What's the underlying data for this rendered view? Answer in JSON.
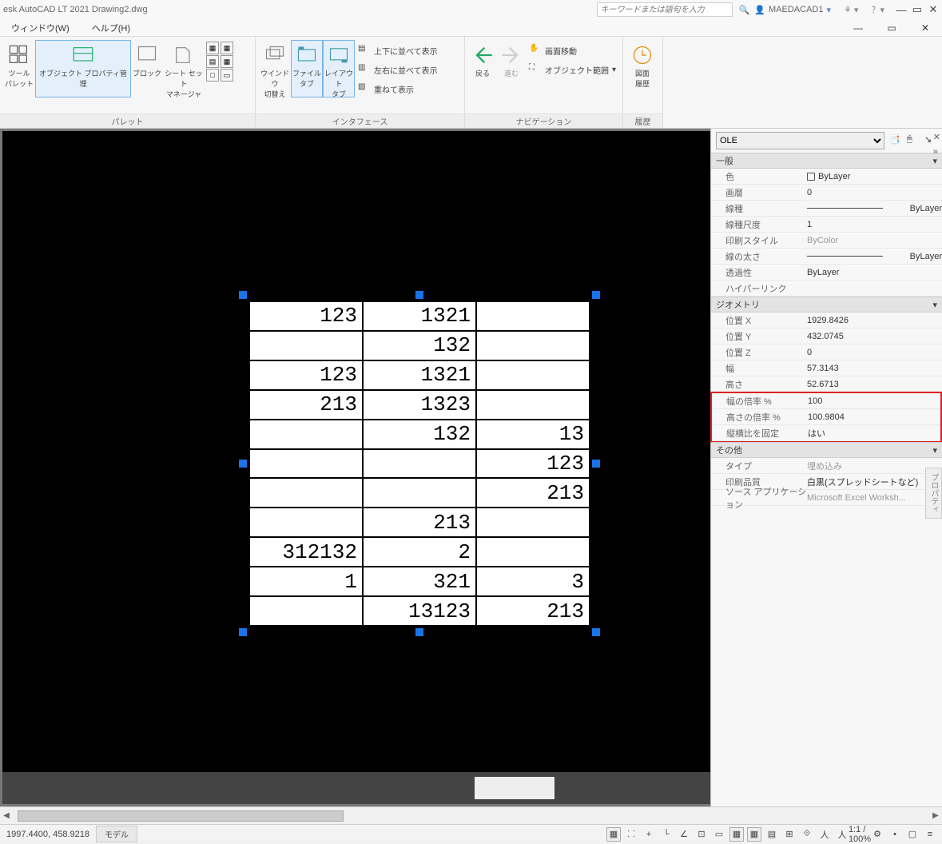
{
  "title": "esk AutoCAD LT 2021   Drawing2.dwg",
  "search_placeholder": "キーワードまたは語句を入力",
  "user": "MAEDACAD1",
  "menu": {
    "window": "ウィンドウ(W)",
    "help": "ヘルプ(H)"
  },
  "ribbon": {
    "palette": {
      "label": "パレット",
      "tool": "ツール\nパレット",
      "prop_mgr": "オブジェクト プロパティ管理",
      "block": "ブロック",
      "sheetset": "シート セット\nマネージャ"
    },
    "interface": {
      "label": "インタフェース",
      "win_switch": "ウインドウ\n切替え",
      "file_tab": "ファイル\nタブ",
      "layout_tab": "レイアウト\nタブ",
      "tile_v": "上下に並べて表示",
      "tile_h": "左右に並べて表示",
      "cascade": "重ねて表示"
    },
    "nav": {
      "label": "ナビゲーション",
      "back": "戻る",
      "forward": "進む",
      "pan": "画面移動",
      "extent": "オブジェクト範囲"
    },
    "hist": {
      "label": "履歴",
      "btn": "図面\n履歴"
    }
  },
  "ole_table": [
    [
      "123",
      "1321",
      ""
    ],
    [
      "",
      "132",
      ""
    ],
    [
      "123",
      "1321",
      ""
    ],
    [
      "213",
      "1323",
      ""
    ],
    [
      "",
      "132",
      "13"
    ],
    [
      "",
      "",
      "123"
    ],
    [
      "",
      "",
      "213"
    ],
    [
      "",
      "213",
      ""
    ],
    [
      "312132",
      "2",
      ""
    ],
    [
      "1",
      "321",
      "3"
    ],
    [
      "",
      "13123",
      "213"
    ]
  ],
  "props": {
    "selector": "OLE",
    "sections": {
      "general": "一般",
      "geometry": "ジオメトリ",
      "other": "その他"
    },
    "general": {
      "color_k": "色",
      "color_v": "ByLayer",
      "layer_k": "画層",
      "layer_v": "0",
      "ltype_k": "線種",
      "ltype_v": "ByLayer",
      "ltscale_k": "線種尺度",
      "ltscale_v": "1",
      "pstyle_k": "印刷スタイル",
      "pstyle_v": "ByColor",
      "lweight_k": "線の太さ",
      "lweight_v": "ByLayer",
      "trans_k": "透過性",
      "trans_v": "ByLayer",
      "hyper_k": "ハイパーリンク",
      "hyper_v": ""
    },
    "geometry": {
      "posx_k": "位置 X",
      "posx_v": "1929.8426",
      "posy_k": "位置 Y",
      "posy_v": "432.0745",
      "posz_k": "位置 Z",
      "posz_v": "0",
      "width_k": "幅",
      "width_v": "57.3143",
      "height_k": "高さ",
      "height_v": "52.6713",
      "wscale_k": "幅の倍率 %",
      "wscale_v": "100",
      "hscale_k": "高さの倍率 %",
      "hscale_v": "100.9804",
      "lock_k": "縦横比を固定",
      "lock_v": "はい"
    },
    "other": {
      "type_k": "タイプ",
      "type_v": "埋め込み",
      "quality_k": "印刷品質",
      "quality_v": "白黒(スプレッドシートなど)",
      "source_k": "ソース アプリケーション",
      "source_v": "Microsoft Excel Worksh..."
    },
    "vtab": "プロパティ"
  },
  "status": {
    "coord": "1997.4400, 458.9218",
    "model_tab": "モデル",
    "zoom": "1:1 / 100%"
  }
}
